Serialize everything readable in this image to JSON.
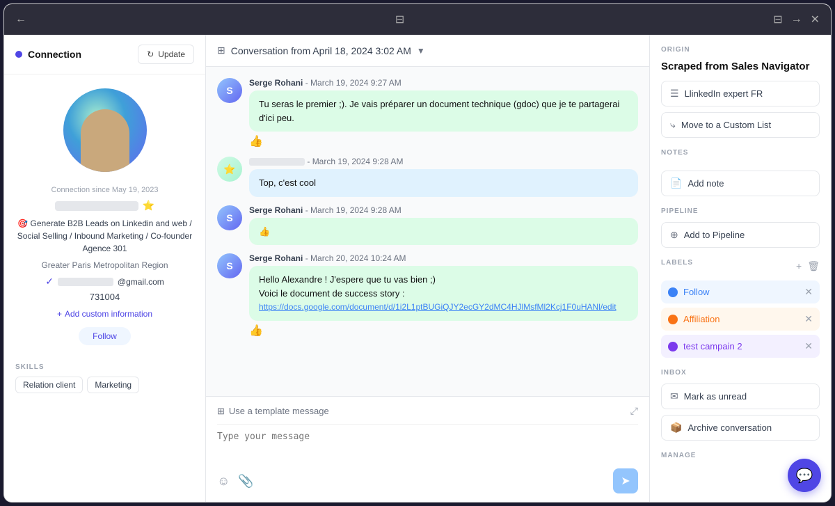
{
  "titleBar": {
    "backIcon": "←",
    "panelIcon": "⊟",
    "panelIcon2": "⊟",
    "forwardIcon": "→",
    "closeIcon": "✕"
  },
  "leftPanel": {
    "connectionLabel": "Connection",
    "updateButton": "Update",
    "sinceText": "Connection since May 19, 2023",
    "bio": "🎯 Generate B2B Leads on Linkedin and web / Social Selling / Inbound Marketing / Co-founder Agence 301",
    "location": "Greater Paris Metropolitan Region",
    "emailSuffix": "@gmail.com",
    "phone": "731004",
    "addCustom": "Add custom information",
    "followLabel": "Follow",
    "skillsHeading": "SKILLS",
    "skills": [
      "Relation client",
      "Marketing"
    ]
  },
  "centerPanel": {
    "conversationTitle": "Conversation from April 18, 2024 3:02 AM",
    "messages": [
      {
        "sender": "Serge Rohani",
        "time": "March 19, 2024 9:27 AM",
        "text": "Tu seras le premier ;). Je vais préparer un document technique (gdoc) que je te partagerai d'ici peu.",
        "reaction": "👍",
        "type": "sent"
      },
      {
        "sender": "blurred",
        "time": "March 19, 2024 9:28 AM",
        "text": "Top, c'est cool",
        "reaction": "",
        "type": "received"
      },
      {
        "sender": "Serge Rohani",
        "time": "March 19, 2024 9:28 AM",
        "text": "👍",
        "reaction": "",
        "type": "sent"
      },
      {
        "sender": "Serge Rohani",
        "time": "March 20, 2024 10:24 AM",
        "text": "Hello Alexandre ! J'espere que tu vas bien ;)\nVoici le document de success story :",
        "link": "https://docs.google.com/document/d/1i2L1ptBUGiQJY2ecGY2dMC4HJlMsfMl2Kcj1F0uHANl/edit",
        "reaction": "👍",
        "type": "sent"
      }
    ],
    "templatePlaceholder": "Use a template message",
    "messagePlaceholder": "Type your message",
    "emojiIcon": "☺",
    "attachIcon": "📎"
  },
  "rightPanel": {
    "originLabel": "ORIGIN",
    "scrapedTitle": "Scraped from Sales Navigator",
    "linkedinListBtn": "LlinkedIn expert FR",
    "moveListBtn": "Move to a Custom List",
    "notesLabel": "NOTES",
    "addNoteBtn": "Add note",
    "pipelineLabel": "PIPELINE",
    "addPipelineBtn": "Add to Pipeline",
    "labelsLabel": "LABELS",
    "labels": [
      {
        "name": "Follow",
        "color": "follow"
      },
      {
        "name": "Affiliation",
        "color": "affiliation"
      },
      {
        "name": "test campain 2",
        "color": "test"
      }
    ],
    "inboxLabel": "INBOX",
    "markUnreadBtn": "Mark as unread",
    "archiveBtn": "Archive conversation",
    "manageLabel": "MANAGE"
  }
}
